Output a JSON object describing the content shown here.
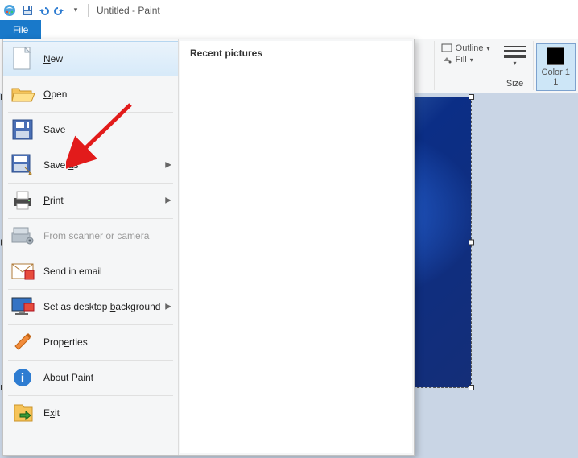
{
  "titlebar": {
    "document": "Untitled",
    "app": "Paint"
  },
  "file_tab": "File",
  "ribbon": {
    "outline": "Outline",
    "fill": "Fill",
    "size": "Size",
    "color1": "Color 1"
  },
  "filemenu": {
    "recent_header": "Recent pictures",
    "items": {
      "new": "New",
      "open": "Open",
      "save": "Save",
      "save_as": "Save as",
      "print": "Print",
      "from_scanner": "From scanner or camera",
      "send_email": "Send in email",
      "set_bg": "Set as desktop background",
      "properties": "Properties",
      "about": "About Paint",
      "exit": "Exit"
    }
  }
}
